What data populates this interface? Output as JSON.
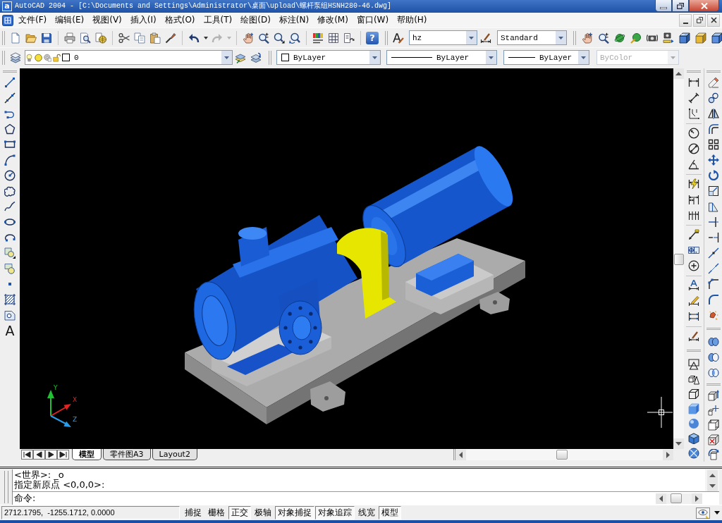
{
  "window": {
    "app_icon": "a",
    "title": "AutoCAD 2004 - [C:\\Documents and Settings\\Administrator\\桌面\\upload\\螺杆泵组HSNH280-46.dwg]"
  },
  "menu_bar": [
    "文件(F)",
    "编辑(E)",
    "视图(V)",
    "插入(I)",
    "格式(O)",
    "工具(T)",
    "绘图(D)",
    "标注(N)",
    "修改(M)",
    "窗口(W)",
    "帮助(H)"
  ],
  "standard_toolbar": {
    "help_button": "?"
  },
  "styles_toolbar": {
    "text_style": "hz",
    "dimension_style": "Standard"
  },
  "layers_toolbar": {
    "current_layer": "0"
  },
  "properties_toolbar": {
    "color_setting": "ByLayer",
    "linetype": "ByLayer",
    "lineweight": "ByLayer",
    "plot_style": {
      "value": "ByColor",
      "disabled": true
    }
  },
  "draw_toolbar": {
    "text_tool": "A"
  },
  "viewport": {
    "ucs_axes": [
      {
        "label": "Y",
        "color": "#22c033"
      },
      {
        "label": "X",
        "color": "#e02424"
      },
      {
        "label": "Z",
        "color": "#2a9de8"
      }
    ]
  },
  "layout_tabs": [
    {
      "label": "模型",
      "selected": true
    },
    {
      "label": "零件图A3",
      "selected": false
    },
    {
      "label": "Layout2",
      "selected": false
    }
  ],
  "command_window": {
    "history": [
      "<世界>: _o",
      "指定新原点 <0,0,0>:"
    ],
    "prompt": "命令:"
  },
  "status_bar": {
    "coordinates": "2712.1795,  -1255.1712, 0.0000",
    "toggles": [
      {
        "label": "捕捉",
        "on": false
      },
      {
        "label": "栅格",
        "on": false
      },
      {
        "label": "正交",
        "on": true
      },
      {
        "label": "极轴",
        "on": false
      },
      {
        "label": "对象捕捉",
        "on": true
      },
      {
        "label": "对象追踪",
        "on": true
      },
      {
        "label": "线宽",
        "on": false
      },
      {
        "label": "模型",
        "on": true
      }
    ]
  }
}
